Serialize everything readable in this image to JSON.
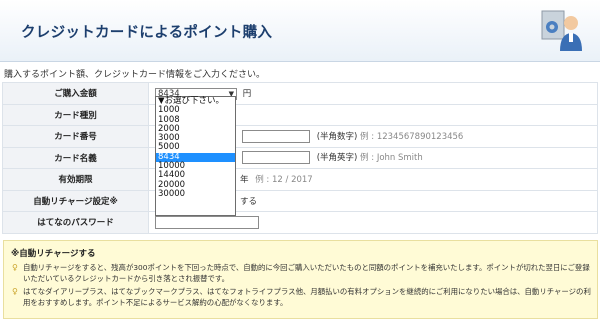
{
  "header": {
    "title": "クレジットカードによるポイント購入"
  },
  "intro": "購入するポイント額、クレジットカード情報をご入力ください。",
  "form": {
    "amount": {
      "label": "ご購入金額",
      "selected": "8434",
      "unit": "円"
    },
    "card_type": {
      "label": "カード種別"
    },
    "card_number": {
      "label": "カード番号",
      "hint": "(半角数字)",
      "example": "例 : 1234567890123456"
    },
    "card_name": {
      "label": "カード名義",
      "hint": "(半角英字)",
      "example": "例 : John Smith"
    },
    "expiry": {
      "label": "有効期限",
      "year_suffix": "年",
      "example": "例 : 12 / 2017"
    },
    "auto_recharge": {
      "label": "自動リチャージ設定※",
      "text": "する"
    },
    "password": {
      "label": "はてなのパスワード"
    }
  },
  "dropdown": {
    "options": [
      "▼お選び下さい。",
      "1000",
      "1008",
      "2000",
      "3000",
      "5000",
      "8434",
      "10000",
      "14400",
      "20000",
      "30000"
    ],
    "selected_index": 6
  },
  "notice": {
    "title": "※自動リチャージする",
    "items": [
      "自動リチャージをすると、残高が300ポイントを下回った時点で、自動的に今回ご購入いただいたものと同額のポイントを補充いたします。ポイントが切れた翌日にご登録いただいているクレジットカードから引き落とされ振替です。",
      "はてなダイアリープラス、はてなブックマークプラス、はてなフォトライフプラス他、月額払いの有料オプションを継続的にご利用になりたい場合は、自動リチャージの利用をおすすめします。ポイント不足によるサービス解約の心配がなくなります。"
    ]
  },
  "colors": {
    "header_title": "#1d3f6e",
    "selected_option": "#1e90ff",
    "notice_bg": "#fffbd6"
  }
}
